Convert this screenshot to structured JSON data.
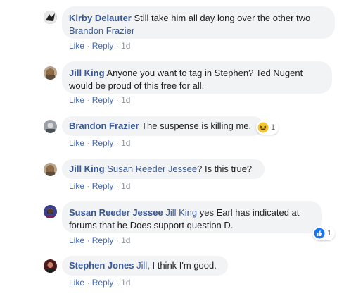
{
  "comments": [
    {
      "author": "Kirby Delauter",
      "text": "Still take him all day long over the other two",
      "mention": "Brandon Frazier",
      "actions": {
        "like": "Like",
        "reply": "Reply",
        "time": "1d"
      }
    },
    {
      "author": "Jill King",
      "text_line1": "Anyone you want to tag in Stephen? Ted Nugent",
      "text_line2": "would be proud of this free for all.",
      "actions": {
        "like": "Like",
        "reply": "Reply",
        "time": "1d"
      }
    },
    {
      "author": "Brandon Frazier",
      "text": "The suspense is killing me.",
      "reaction": {
        "icon": "haha-emoji-icon",
        "count": "1"
      },
      "actions": {
        "like": "Like",
        "reply": "Reply",
        "time": "1d"
      }
    },
    {
      "author": "Jill King",
      "mention": "Susan Reeder Jessee",
      "text": "? Is this true?",
      "actions": {
        "like": "Like",
        "reply": "Reply",
        "time": "1d"
      }
    },
    {
      "author": "Susan Reeder Jessee",
      "mention": "Jill King",
      "text_line1": " yes Earl has indicated at",
      "text_line2": "forums that he Does support question D.",
      "reaction": {
        "icon": "thumbs-up-icon",
        "count": "1"
      },
      "actions": {
        "like": "Like",
        "reply": "Reply",
        "time": "1d"
      }
    },
    {
      "author": "Stephen Jones",
      "mention": "Jill",
      "text": ", I think I'm good.",
      "actions": {
        "like": "Like",
        "reply": "Reply",
        "time": "1d"
      }
    }
  ],
  "separator": "·",
  "colors": {
    "link": "#385898",
    "action": "#4267b2",
    "bubble": "#f2f3f5",
    "meta": "#90949c"
  }
}
